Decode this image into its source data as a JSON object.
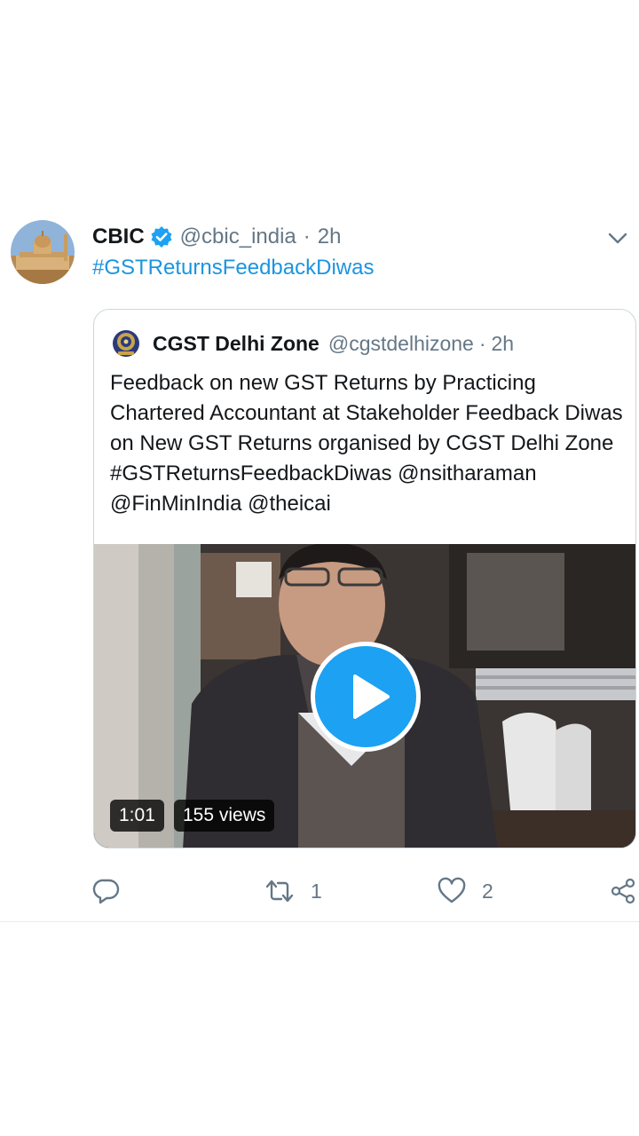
{
  "tweet": {
    "author_name": "CBIC",
    "author_handle": "@cbic_india",
    "separator": "·",
    "time": "2h",
    "text": "#GSTReturnsFeedbackDiwas",
    "verified": true
  },
  "quoted_tweet": {
    "author_name": "CGST Delhi Zone",
    "author_handle": "@cgstdelhizone",
    "separator": "·",
    "time": "2h",
    "text": "Feedback on new GST Returns by Practicing Chartered Accountant at Stakeholder Feedback Diwas on New GST Returns organised by CGST Delhi Zone #GSTReturnsFeedbackDiwas  @nsitharaman @FinMinIndia @theicai",
    "video": {
      "duration": "1:01",
      "views": "155 views"
    }
  },
  "actions": {
    "reply_count": "",
    "retweet_count": "1",
    "like_count": "2"
  },
  "icons": {
    "verified": "verified-badge-icon",
    "caret": "chevron-down-icon",
    "reply": "reply-icon",
    "retweet": "retweet-icon",
    "like": "heart-icon",
    "share": "share-icon",
    "play": "play-icon"
  },
  "colors": {
    "link": "#1b95e0",
    "verified": "#1da1f2",
    "play_button": "#1da1f2",
    "secondary_text": "#657786",
    "border": "#ccd6dd"
  }
}
